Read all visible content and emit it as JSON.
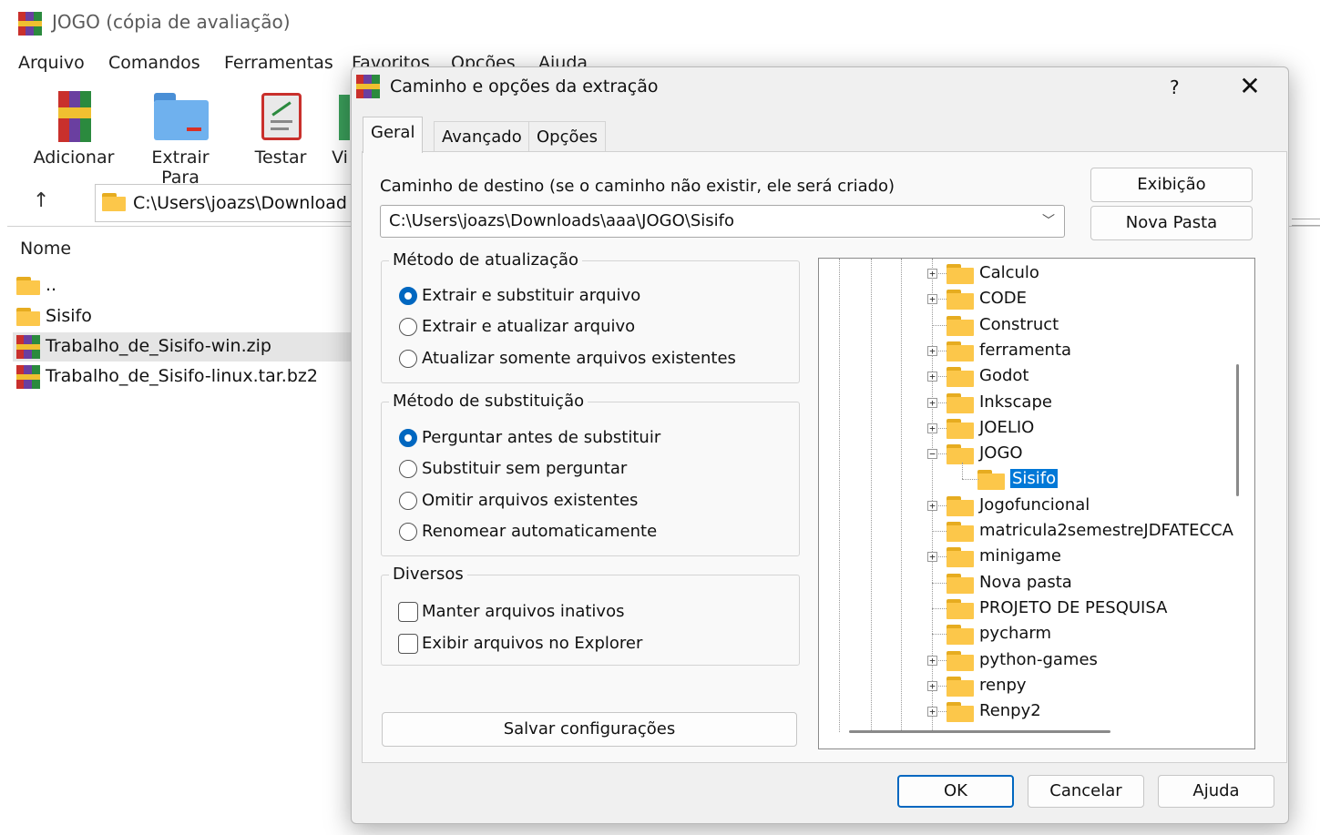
{
  "window": {
    "title": "JOGO (cópia de avaliação)",
    "menu": [
      "Arquivo",
      "Comandos",
      "Ferramentas",
      "Favoritos",
      "Opções",
      "Ajuda"
    ],
    "toolbar": [
      "Adicionar",
      "Extrair Para",
      "Testar",
      "Vi"
    ],
    "address": "C:\\Users\\joazs\\Download",
    "column_name": "Nome",
    "files": [
      "..",
      "Sisifo",
      "Trabalho_de_Sisifo-win.zip",
      "Trabalho_de_Sisifo-linux.tar.bz2"
    ]
  },
  "dialog": {
    "title": "Caminho e opções da extração",
    "help_label": "?",
    "close_label": "✕",
    "tabs": [
      "Geral",
      "Avançado",
      "Opções"
    ],
    "dest_label": "Caminho de destino (se o caminho não existir, ele será criado)",
    "dest_value": "C:\\Users\\joazs\\Downloads\\aaa\\JOGO\\Sisifo",
    "btn_view": "Exibição",
    "btn_new_folder": "Nova Pasta",
    "update_group": {
      "title": "Método de atualização",
      "options": [
        "Extrair e substituir arquivo",
        "Extrair e atualizar arquivo",
        "Atualizar somente arquivos existentes"
      ],
      "selected": 0
    },
    "overwrite_group": {
      "title": "Método de substituição",
      "options": [
        "Perguntar antes de substituir",
        "Substituir sem perguntar",
        "Omitir arquivos existentes",
        "Renomear automaticamente"
      ],
      "selected": 0
    },
    "misc_group": {
      "title": "Diversos",
      "options": [
        "Manter arquivos inativos",
        "Exibir arquivos no Explorer"
      ]
    },
    "btn_save": "Salvar configurações",
    "tree": [
      {
        "label": "Calculo",
        "expander": "+"
      },
      {
        "label": "CODE",
        "expander": "+"
      },
      {
        "label": "Construct",
        "expander": ""
      },
      {
        "label": "ferramenta",
        "expander": "+"
      },
      {
        "label": "Godot",
        "expander": "+"
      },
      {
        "label": "Inkscape",
        "expander": "+"
      },
      {
        "label": "JOELIO",
        "expander": "+"
      },
      {
        "label": "JOGO",
        "expander": "−"
      },
      {
        "label": "Sisifo",
        "expander": "",
        "child": true,
        "selected": true
      },
      {
        "label": "Jogofuncional",
        "expander": "+"
      },
      {
        "label": "matricula2semestreJDFATECCA",
        "expander": ""
      },
      {
        "label": "minigame",
        "expander": "+"
      },
      {
        "label": "Nova pasta",
        "expander": ""
      },
      {
        "label": "PROJETO DE PESQUISA",
        "expander": ""
      },
      {
        "label": "pycharm",
        "expander": ""
      },
      {
        "label": "python-games",
        "expander": "+"
      },
      {
        "label": "renpy",
        "expander": "+"
      },
      {
        "label": "Renpy2",
        "expander": "+"
      }
    ],
    "btn_ok": "OK",
    "btn_cancel": "Cancelar",
    "btn_help": "Ajuda"
  }
}
